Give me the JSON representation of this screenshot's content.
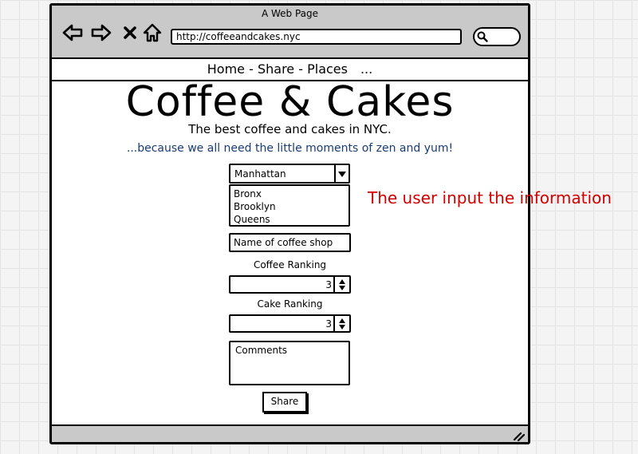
{
  "window": {
    "title": "A Web Page",
    "address": "http://coffeeandcakes.nyc",
    "icons": [
      "back-arrow-icon",
      "forward-arrow-icon",
      "close-icon",
      "home-icon",
      "search-icon",
      "resize-grip-icon"
    ]
  },
  "nav": {
    "items": [
      "Home",
      "Share",
      "Places"
    ],
    "separator": " - ",
    "overflow": "..."
  },
  "header": {
    "title": "Coffee & Cakes",
    "subtitle": "The best coffee and cakes in NYC.",
    "tagline": "...because we all need the little moments of zen and yum!"
  },
  "form": {
    "borough": {
      "selected": "Manhattan",
      "options": [
        "Bronx",
        "Brooklyn",
        "Queens"
      ]
    },
    "shop_name_placeholder": "Name of coffee shop",
    "coffee_label": "Coffee Ranking",
    "coffee_value": "3",
    "cake_label": "Cake Ranking",
    "cake_value": "3",
    "comments_placeholder": "Comments",
    "share_label": "Share"
  },
  "annotation": {
    "text": "The user input the information",
    "color": "#d40000"
  },
  "colors": {
    "chrome": "#c9c9c9",
    "tagline": "#1a3c74"
  }
}
